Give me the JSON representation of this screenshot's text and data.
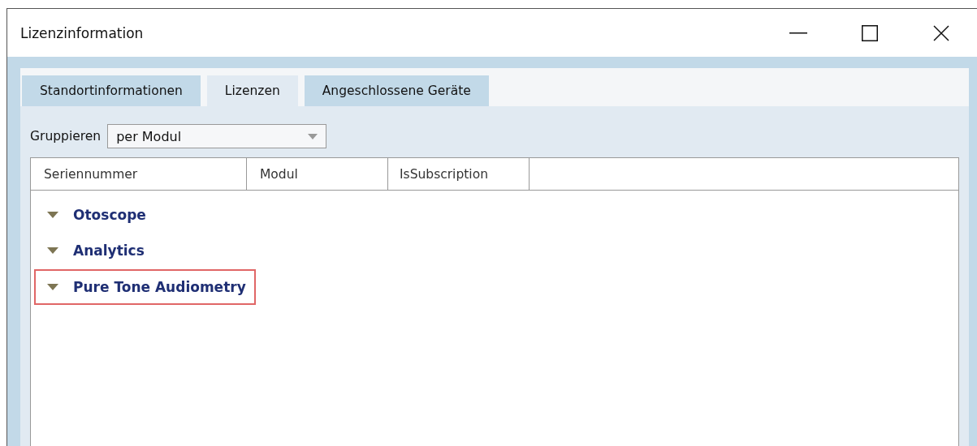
{
  "window": {
    "title": "Lizenzinformation"
  },
  "tabs": [
    {
      "label": "Standortinformationen",
      "selected": false
    },
    {
      "label": "Lizenzen",
      "selected": true
    },
    {
      "label": "Angeschlossene Geräte",
      "selected": false
    }
  ],
  "group_by": {
    "label": "Gruppieren",
    "value": "per Modul"
  },
  "table": {
    "columns": [
      "Seriennummer",
      "Modul",
      "IsSubscription"
    ],
    "groups": [
      {
        "label": "Otoscope",
        "expanded": true,
        "highlighted": false
      },
      {
        "label": "Analytics",
        "expanded": true,
        "highlighted": false
      },
      {
        "label": "Pure Tone Audiometry",
        "expanded": true,
        "highlighted": true
      }
    ]
  }
}
